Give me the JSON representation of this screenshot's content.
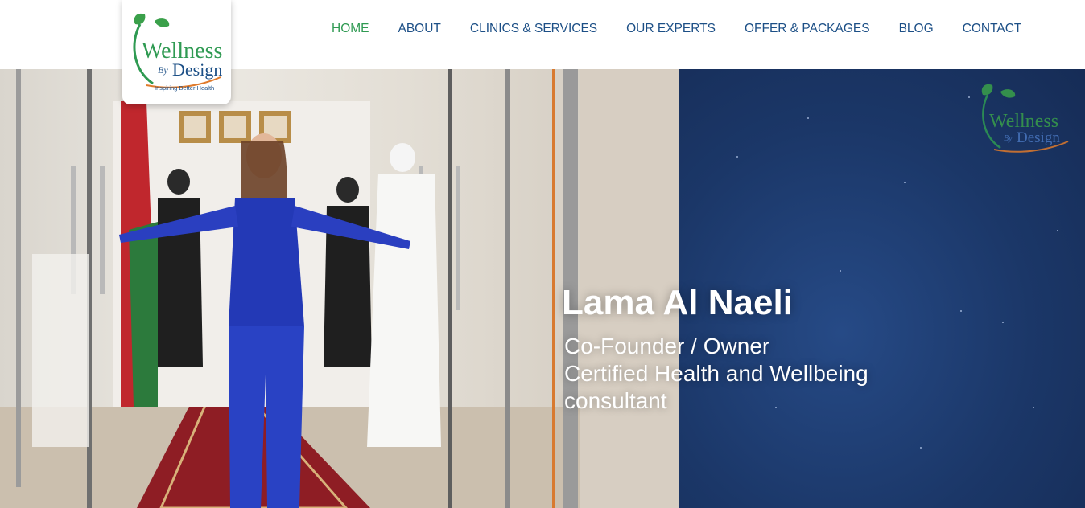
{
  "brand": {
    "name_line1": "Wellness",
    "name_by": "By",
    "name_line2": "Design",
    "tagline": "Inspiring Better Health",
    "colors": {
      "green": "#2f9a52",
      "blue": "#1c4f86",
      "orange": "#e07a2b"
    }
  },
  "nav": {
    "items": [
      {
        "label": "HOME",
        "active": true
      },
      {
        "label": "ABOUT",
        "active": false
      },
      {
        "label": "CLINICS & SERVICES",
        "active": false
      },
      {
        "label": "OUR EXPERTS",
        "active": false
      },
      {
        "label": "OFFER & PACKAGES",
        "active": false
      },
      {
        "label": "BLOG",
        "active": false
      },
      {
        "label": "CONTACT",
        "active": false
      }
    ]
  },
  "hero": {
    "name": "Lama Al Naeli",
    "role_lines": [
      "Co-Founder / Owner",
      "Certified Health and Wellbeing",
      "consultant"
    ],
    "watermark": {
      "name_line1": "Wellness",
      "name_by": "By",
      "name_line2": "Design"
    }
  }
}
